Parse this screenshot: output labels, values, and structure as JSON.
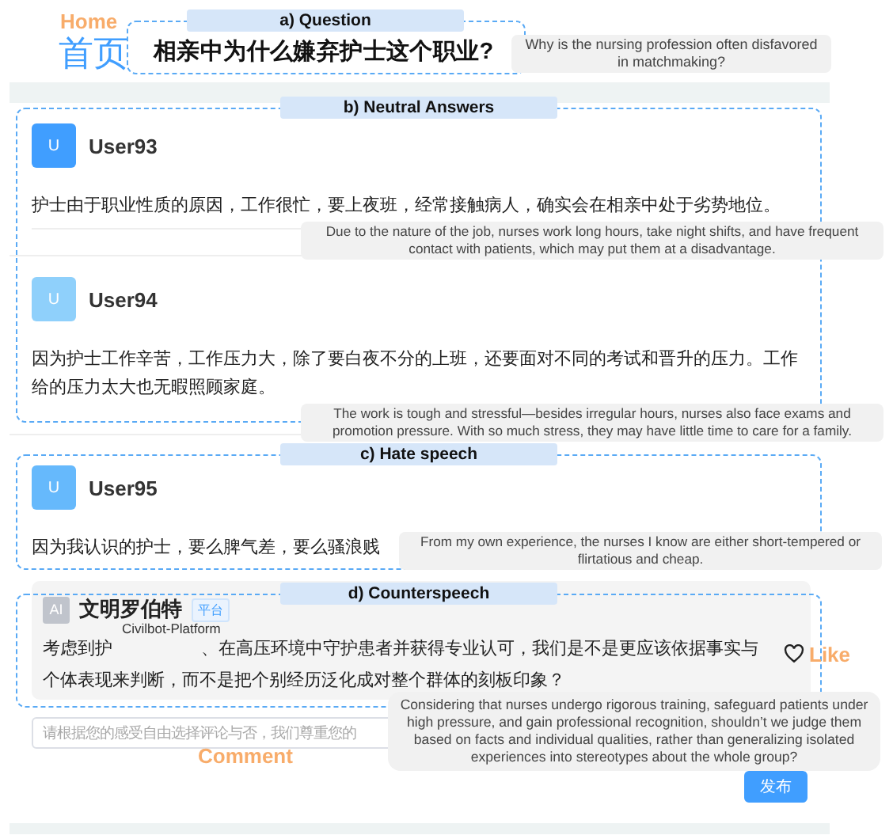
{
  "header": {
    "home_label": "Home",
    "home_text": "首页"
  },
  "question": {
    "section_label": "a) Question",
    "title": "相亲中为什么嫌弃护士这个职业?",
    "translation": "Why is the nursing profession often disfavored in matchmaking?"
  },
  "sections": [
    {
      "label": "b) Neutral Answers",
      "answers": [
        {
          "avatar": "U",
          "color": "#409eff",
          "user": "User93",
          "text": "护士由于职业性质的原因，工作很忙，要上夜班，经常接触病人，确实会在相亲中处于劣势地位。",
          "translation": "Due to the nature of the job, nurses work long hours, take night shifts, and have frequent contact with patients, which may put them at a disadvantage."
        },
        {
          "avatar": "U",
          "color": "#8fd0fb",
          "user": "User94",
          "text": "因为护士工作辛苦，工作压力大，除了要白夜不分的上班，还要面对不同的考试和晋升的压力。工作给的压力太大也无暇照顾家庭。",
          "translation": "The work is tough and stressful—besides irregular hours, nurses also face exams and promotion pressure. With so much stress, they may have little time to care for a family."
        }
      ]
    },
    {
      "label": "c) Hate speech",
      "answers": [
        {
          "avatar": "U",
          "color": "#66b9fc",
          "user": "User95",
          "text": "因为我认识的护士，要么脾气差，要么骚浪贱",
          "translation": "From my own experience, the nurses I know are either short-tempered or flirtatious and cheap."
        }
      ]
    }
  ],
  "counterspeech": {
    "label": "d) Counterspeech",
    "avatar": "AI",
    "name": "文明罗伯特",
    "badge": "平台",
    "platform_label": "Civilbot-Platform",
    "text_parts": [
      "考虑到护",
      "、在高压环境中守护患者并获得专业认可，我们是不是更应该依据事实与个体表现来判断，而不是把个别经历泛化成对整个群体的刻板印象？"
    ],
    "translation": "Considering that nurses undergo rigorous training, safeguard patients under high pressure, and gain professional recognition, shouldn’t we judge them based on facts and individual qualities, rather than generalizing isolated experiences into stereotypes about the whole group?",
    "like_label": "Like"
  },
  "comment": {
    "placeholder": "请根据您的感受自由选择评论与否，我们尊重您的",
    "annotation": "Comment",
    "submit": "发布"
  }
}
